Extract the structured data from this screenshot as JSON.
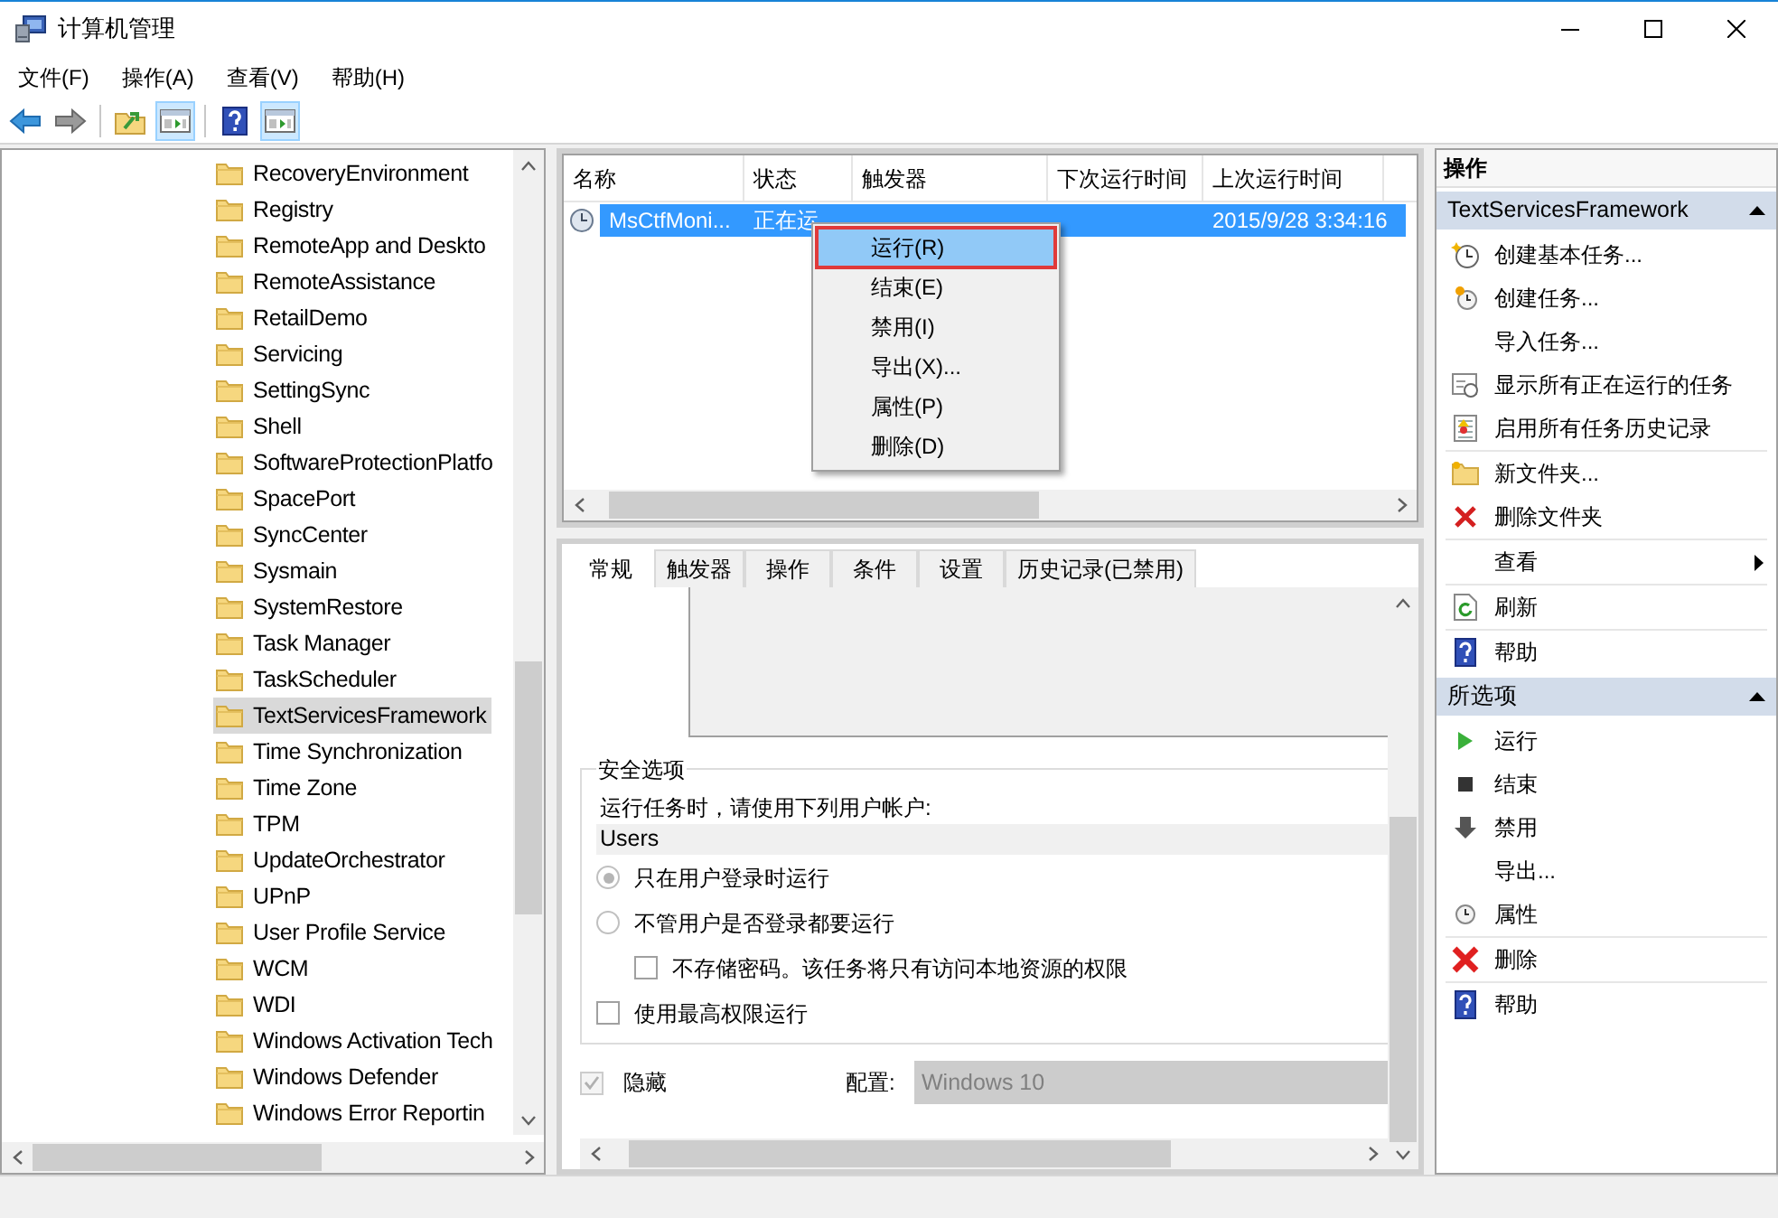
{
  "window": {
    "title": "计算机管理"
  },
  "menu": [
    "文件(F)",
    "操作(A)",
    "查看(V)",
    "帮助(H)"
  ],
  "tree": {
    "items": [
      {
        "label": "RecoveryEnvironment",
        "selected": false
      },
      {
        "label": "Registry",
        "selected": false
      },
      {
        "label": "RemoteApp and Deskto",
        "selected": false
      },
      {
        "label": "RemoteAssistance",
        "selected": false
      },
      {
        "label": "RetailDemo",
        "selected": false
      },
      {
        "label": "Servicing",
        "selected": false
      },
      {
        "label": "SettingSync",
        "selected": false
      },
      {
        "label": "Shell",
        "selected": false
      },
      {
        "label": "SoftwareProtectionPlatfo",
        "selected": false
      },
      {
        "label": "SpacePort",
        "selected": false
      },
      {
        "label": "SyncCenter",
        "selected": false
      },
      {
        "label": "Sysmain",
        "selected": false
      },
      {
        "label": "SystemRestore",
        "selected": false
      },
      {
        "label": "Task Manager",
        "selected": false
      },
      {
        "label": "TaskScheduler",
        "selected": false
      },
      {
        "label": "TextServicesFramework",
        "selected": true
      },
      {
        "label": "Time Synchronization",
        "selected": false
      },
      {
        "label": "Time Zone",
        "selected": false
      },
      {
        "label": "TPM",
        "selected": false
      },
      {
        "label": "UpdateOrchestrator",
        "selected": false
      },
      {
        "label": "UPnP",
        "selected": false
      },
      {
        "label": "User Profile Service",
        "selected": false
      },
      {
        "label": "WCM",
        "selected": false
      },
      {
        "label": "WDI",
        "selected": false
      },
      {
        "label": "Windows Activation Tech",
        "selected": false
      },
      {
        "label": "Windows Defender",
        "selected": false
      },
      {
        "label": "Windows Error Reportin",
        "selected": false
      }
    ]
  },
  "task_list": {
    "columns": [
      "名称",
      "状态",
      "触发器",
      "下次运行时间",
      "上次运行时间"
    ],
    "rows": [
      {
        "selected": true,
        "name": "MsCtfMoni...",
        "status": "正在运",
        "last_run": "2015/9/28 3:34:16"
      }
    ]
  },
  "context_menu": {
    "items": [
      {
        "label": "运行(R)",
        "selected": true
      },
      {
        "label": "结束(E)",
        "selected": false
      },
      {
        "label": "禁用(I)",
        "selected": false
      },
      {
        "label": "导出(X)...",
        "selected": false
      },
      {
        "label": "属性(P)",
        "selected": false
      },
      {
        "label": "删除(D)",
        "selected": false
      }
    ]
  },
  "details": {
    "tabs": [
      {
        "label": "常规",
        "selected": true
      },
      {
        "label": "触发器",
        "selected": false
      },
      {
        "label": "操作",
        "selected": false
      },
      {
        "label": "条件",
        "selected": false
      },
      {
        "label": "设置",
        "selected": false
      },
      {
        "label": "历史记录(已禁用)",
        "selected": false
      }
    ],
    "security_group": {
      "title": "安全选项",
      "account_prompt": "运行任务时，请使用下列用户帐户:",
      "account": "Users",
      "options": [
        {
          "kind": "radio",
          "label": "只在用户登录时运行",
          "checked": true,
          "indented": false
        },
        {
          "kind": "radio",
          "label": "不管用户是否登录都要运行",
          "checked": false,
          "indented": false
        },
        {
          "kind": "checkbox",
          "label": "不存储密码。该任务将只有访问本地资源的权限",
          "checked": false,
          "indented": true
        },
        {
          "kind": "checkbox",
          "label": "使用最高权限运行",
          "checked": false,
          "indented": false
        }
      ]
    },
    "hidden": {
      "label": "隐藏",
      "checked": true,
      "disabled": true
    },
    "config": {
      "label": "配置:",
      "value": "Windows 10",
      "disabled": true
    }
  },
  "actions": {
    "title": "操作",
    "sections": [
      {
        "title": "TextServicesFramework",
        "expanded": true,
        "groups": [
          [
            {
              "label": "创建基本任务...",
              "kind": "command"
            },
            {
              "label": "创建任务...",
              "kind": "command"
            },
            {
              "label": "导入任务...",
              "kind": "command"
            },
            {
              "label": "显示所有正在运行的任务",
              "kind": "command"
            },
            {
              "label": "启用所有任务历史记录",
              "kind": "command"
            }
          ],
          [
            {
              "label": "新文件夹...",
              "kind": "command"
            },
            {
              "label": "删除文件夹",
              "kind": "command"
            }
          ],
          [
            {
              "label": "查看",
              "kind": "submenu"
            }
          ],
          [
            {
              "label": "刷新",
              "kind": "command"
            }
          ],
          [
            {
              "label": "帮助",
              "kind": "command"
            }
          ]
        ]
      },
      {
        "title": "所选项",
        "expanded": true,
        "groups": [
          [
            {
              "label": "运行",
              "kind": "command"
            },
            {
              "label": "结束",
              "kind": "command"
            },
            {
              "label": "禁用",
              "kind": "command"
            },
            {
              "label": "导出...",
              "kind": "command"
            },
            {
              "label": "属性",
              "kind": "command"
            }
          ],
          [
            {
              "label": "删除",
              "kind": "command"
            }
          ],
          [
            {
              "label": "帮助",
              "kind": "command"
            }
          ]
        ]
      }
    ]
  }
}
